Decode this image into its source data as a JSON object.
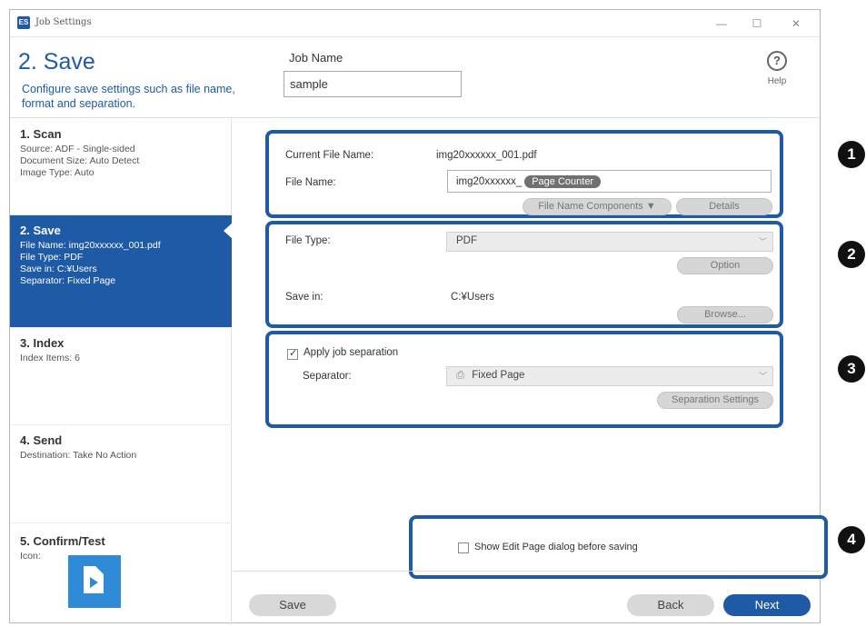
{
  "window": {
    "title": "Job Settings",
    "app_icon_text": "ES",
    "controls": {
      "minimize": "—",
      "maximize": "☐",
      "close": "✕"
    }
  },
  "header": {
    "step_title": "2. Save",
    "description": "Configure save settings such as file name, format and separation.",
    "job_name_label": "Job Name",
    "job_name_value": "sample",
    "help_symbol": "?",
    "help_label": "Help"
  },
  "sidebar": {
    "steps": [
      {
        "title": "1. Scan",
        "lines": [
          "Source: ADF - Single-sided",
          "Document Size: Auto Detect",
          "Image Type: Auto"
        ],
        "active": false
      },
      {
        "title": "2. Save",
        "lines": [
          "File Name: img20xxxxxx_001.pdf",
          "File Type: PDF",
          "Save in: C:¥Users",
          "Separator: Fixed Page"
        ],
        "active": true
      },
      {
        "title": "3. Index",
        "lines": [
          "Index Items: 6"
        ],
        "active": false
      },
      {
        "title": "4. Send",
        "lines": [
          "Destination: Take No Action"
        ],
        "active": false
      },
      {
        "title": "5. Confirm/Test",
        "lines": [
          "Icon:"
        ],
        "active": false
      }
    ]
  },
  "group1": {
    "current_label": "Current File Name:",
    "current_value": "img20xxxxxx_001.pdf",
    "file_name_label": "File Name:",
    "file_name_prefix": "img20xxxxxx_",
    "file_name_token": "Page Counter",
    "components_button": "File Name Components ▼",
    "details_button": "Details"
  },
  "group2": {
    "file_type_label": "File Type:",
    "file_type_value": "PDF",
    "option_button": "Option",
    "save_in_label": "Save in:",
    "save_in_value": "C:¥Users",
    "browse_button": "Browse..."
  },
  "group3": {
    "apply_label": "Apply job separation",
    "apply_checked": true,
    "separator_label": "Separator:",
    "separator_value": "Fixed Page",
    "separation_settings_button": "Separation Settings"
  },
  "group4": {
    "show_edit_label": "Show Edit Page dialog before saving",
    "show_edit_checked": false
  },
  "badges": [
    "1",
    "2",
    "3",
    "4"
  ],
  "footer": {
    "save_button": "Save",
    "back_button": "Back",
    "next_button": "Next"
  },
  "colors": {
    "accent": "#1f5aa6",
    "icon_blue": "#2f8ad8",
    "badge": "#111111"
  }
}
